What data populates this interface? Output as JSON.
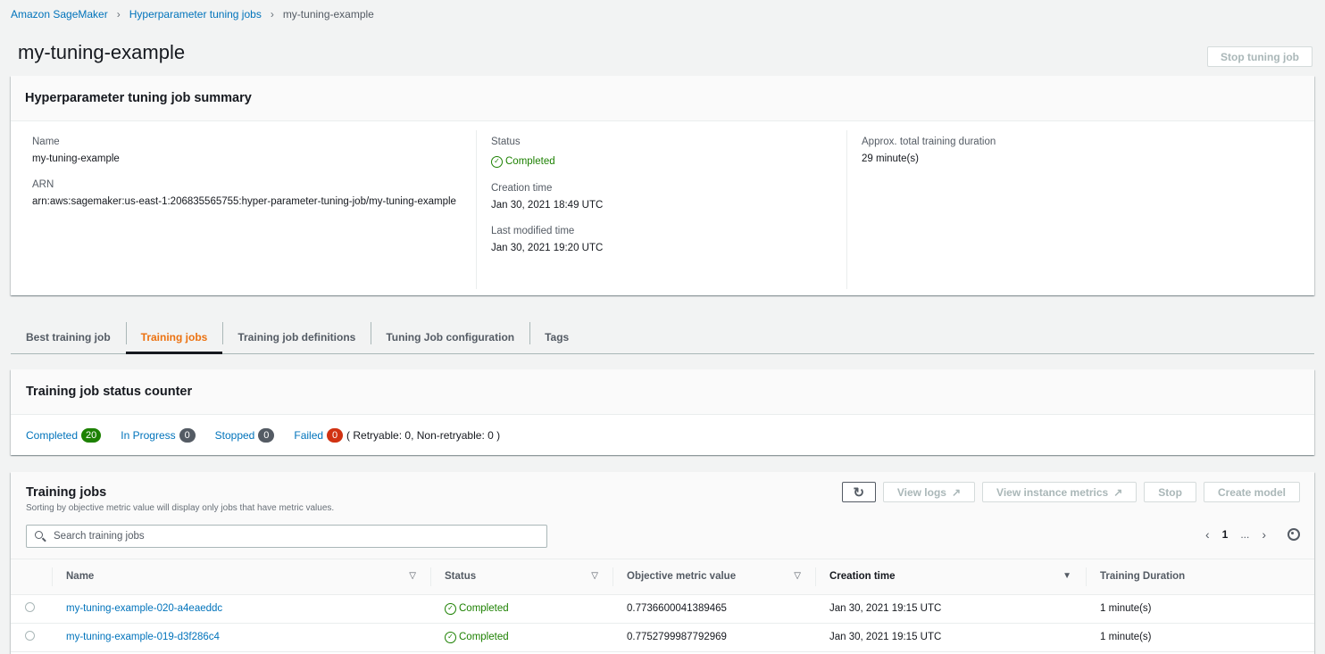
{
  "breadcrumb": {
    "items": [
      "Amazon SageMaker",
      "Hyperparameter tuning jobs"
    ],
    "current": "my-tuning-example"
  },
  "page": {
    "title": "my-tuning-example",
    "stop_button": "Stop tuning job"
  },
  "summary": {
    "title": "Hyperparameter tuning job summary",
    "name_label": "Name",
    "name_value": "my-tuning-example",
    "arn_label": "ARN",
    "arn_value": "arn:aws:sagemaker:us-east-1:206835565755:hyper-parameter-tuning-job/my-tuning-example",
    "status_label": "Status",
    "status_value": "Completed",
    "creation_label": "Creation time",
    "creation_value": "Jan 30, 2021 18:49 UTC",
    "modified_label": "Last modified time",
    "modified_value": "Jan 30, 2021 19:20 UTC",
    "duration_label": "Approx. total training duration",
    "duration_value": "29 minute(s)"
  },
  "tabs": [
    {
      "label": "Best training job"
    },
    {
      "label": "Training jobs"
    },
    {
      "label": "Training job definitions"
    },
    {
      "label": "Tuning Job configuration"
    },
    {
      "label": "Tags"
    }
  ],
  "active_tab": "Training jobs",
  "counter": {
    "title": "Training job status counter",
    "items": [
      {
        "label": "Completed",
        "count": "20",
        "color": "#1d8102"
      },
      {
        "label": "In Progress",
        "count": "0",
        "color": "#545b64"
      },
      {
        "label": "Stopped",
        "count": "0",
        "color": "#545b64"
      },
      {
        "label": "Failed",
        "count": "0",
        "color": "#d13212"
      }
    ],
    "retry_note": "( Retryable: 0, Non-retryable: 0 )"
  },
  "jobs": {
    "title": "Training jobs",
    "description": "Sorting by objective metric value will display only jobs that have metric values.",
    "buttons": {
      "view_logs": "View logs",
      "view_metrics": "View instance metrics",
      "stop": "Stop",
      "create_model": "Create model"
    },
    "search_placeholder": "Search training jobs",
    "pager": {
      "page": "1",
      "ellipsis": "..."
    },
    "columns": [
      "Name",
      "Status",
      "Objective metric value",
      "Creation time",
      "Training Duration"
    ],
    "rows": [
      {
        "name": "my-tuning-example-020-a4eaeddc",
        "status": "Completed",
        "metric": "0.7736600041389465",
        "created": "Jan 30, 2021 19:15 UTC",
        "duration": "1 minute(s)"
      },
      {
        "name": "my-tuning-example-019-d3f286c4",
        "status": "Completed",
        "metric": "0.7752799987792969",
        "created": "Jan 30, 2021 19:15 UTC",
        "duration": "1 minute(s)"
      }
    ]
  },
  "colors": {
    "link": "#0073bb",
    "success": "#1d8102",
    "accent": "#ec7211",
    "danger": "#d13212"
  }
}
